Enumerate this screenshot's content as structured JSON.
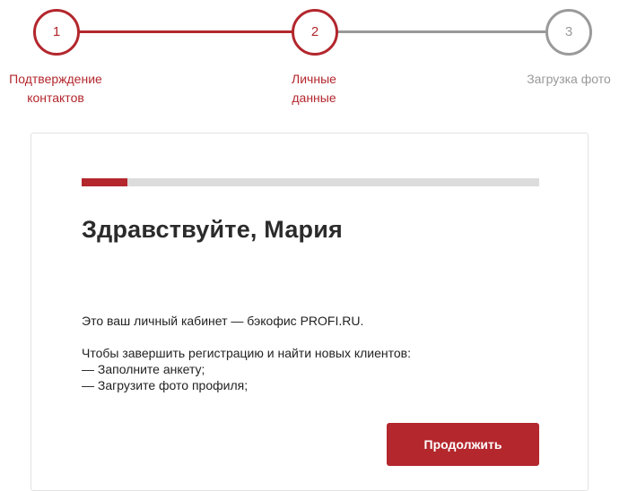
{
  "stepper": {
    "steps": [
      {
        "number": "1",
        "label": "Подтверждение\nконтактов",
        "state": "done"
      },
      {
        "number": "2",
        "label": "Личные\nданные",
        "state": "current"
      },
      {
        "number": "3",
        "label": "Загрузка фото",
        "state": "todo"
      }
    ],
    "colors": {
      "active": "#b3272d",
      "inactive": "#999999"
    }
  },
  "card": {
    "progress": 0.1,
    "heading": "Здравствуйте, Мария",
    "intro": "Это ваш личный кабинет — бэкофис PROFI.RU.",
    "instructions_title": "Чтобы завершить регистрацию и найти новых клиентов:",
    "instructions": [
      "— Заполните анкету;",
      "— Загрузите фото профиля;"
    ],
    "continue_label": "Продолжить"
  }
}
